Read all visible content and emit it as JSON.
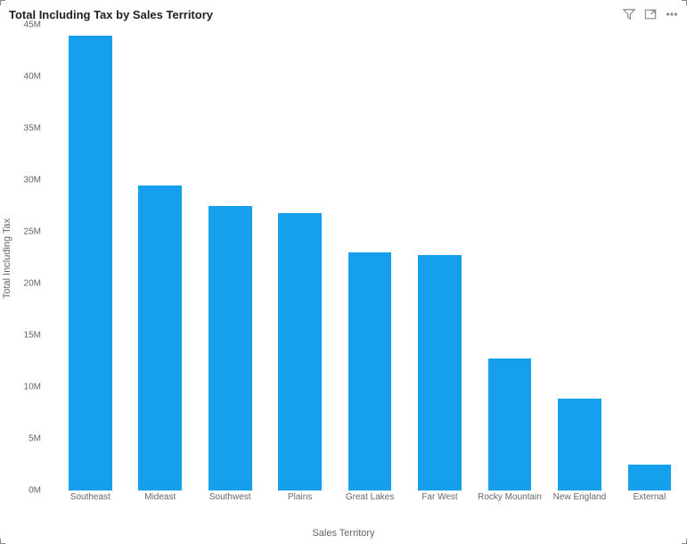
{
  "header": {
    "title": "Total Including Tax by Sales Territory",
    "icons": {
      "filter": "filter-icon",
      "focus": "focus-mode-icon",
      "more": "more-options-icon"
    }
  },
  "colors": {
    "bar": "#169fec",
    "text": "#666666"
  },
  "chart_data": {
    "type": "bar",
    "title": "Total Including Tax by Sales Territory",
    "xlabel": "Sales Territory",
    "ylabel": "Total Including Tax",
    "ylim": [
      0,
      45000000
    ],
    "y_ticks": [
      "0M",
      "5M",
      "10M",
      "15M",
      "20M",
      "25M",
      "30M",
      "35M",
      "40M",
      "45M"
    ],
    "categories": [
      "Southeast",
      "Mideast",
      "Southwest",
      "Plains",
      "Great Lakes",
      "Far West",
      "Rocky Mountain",
      "New England",
      "External"
    ],
    "values": [
      44000000,
      29500000,
      27500000,
      26800000,
      23000000,
      22800000,
      12800000,
      8900000,
      2500000
    ]
  }
}
